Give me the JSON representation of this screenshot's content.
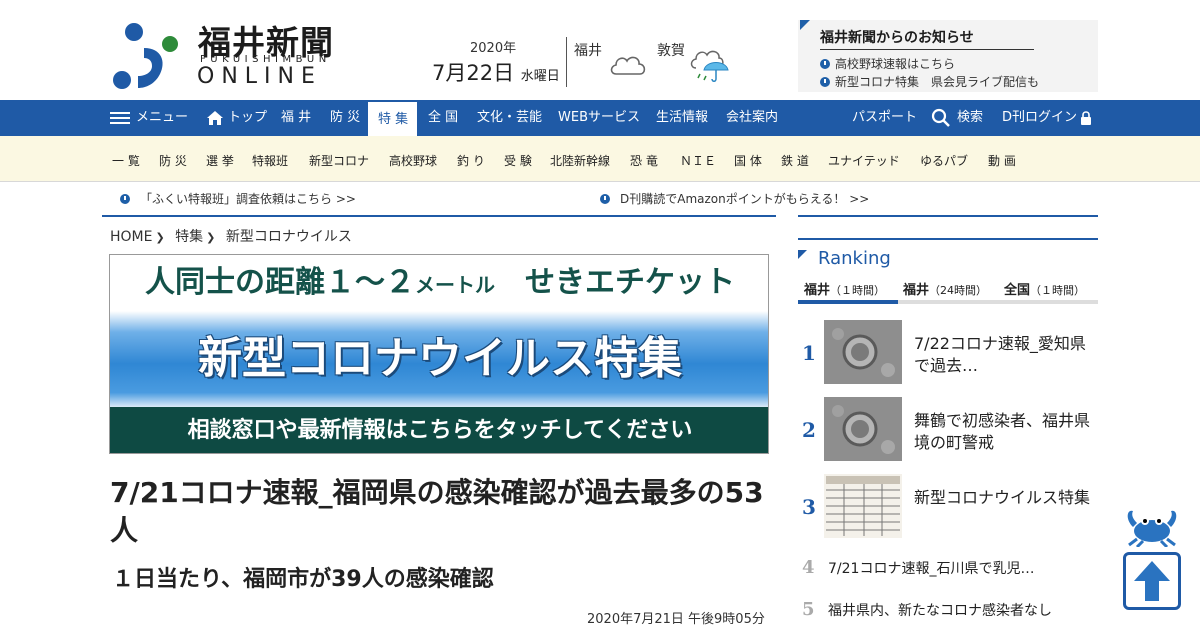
{
  "header": {
    "logo_title": "福井新聞",
    "logo_sub": "FUKUISHIMBUN",
    "logo_online": "ONLINE",
    "date_year": "2020年",
    "date_day": "7月22日",
    "date_weekday": "水曜日",
    "weather": [
      {
        "city": "福井",
        "icon": "cloud-icon"
      },
      {
        "city": "敦賀",
        "icon": "cloud-umbrella-icon"
      }
    ],
    "notice": {
      "title": "福井新聞からのお知らせ",
      "items": [
        "高校野球速報はこちら",
        "新型コロナ特集　県会見ライブ配信も"
      ]
    }
  },
  "nav": {
    "menu_label": "メニュー",
    "items": [
      "トップ",
      "福 井",
      "防 災",
      "特 集",
      "全 国",
      "文化・芸能",
      "WEBサービス",
      "生活情報",
      "会社案内"
    ],
    "active": "特 集",
    "right": {
      "passport": "パスポート",
      "search": "検索",
      "login": "D刊ログイン"
    }
  },
  "subnav": [
    "一 覧",
    "防 災",
    "選 挙",
    "特報班",
    "新型コロナ",
    "高校野球",
    "釣 り",
    "受 験",
    "北陸新幹線",
    "恐 竜",
    "ＮＩＥ",
    "国 体",
    "鉄 道",
    "ユナイテッド",
    "ゆるパブ",
    "動 画"
  ],
  "ticker": [
    "「ふくい特報班」調査依頼はこちら >>",
    "D刊購読でAmazonポイントがもらえる！ >>"
  ],
  "breadcrumb": [
    "HOME",
    "特集",
    "新型コロナウイルス"
  ],
  "banner": {
    "top_a": "人同士の距離１～２",
    "top_b": "メートル",
    "top_c": "　せきエチケット",
    "mid": "新型コロナウイルス特集",
    "bottom": "相談窓口や最新情報はこちらをタッチしてください"
  },
  "article": {
    "headline": "7/21コロナ速報_福岡県の感染確認が過去最多の53人",
    "subhead": "１日当たり、福岡市が39人の感染確認",
    "date": "2020年7月21日 午後9時05分"
  },
  "ranking": {
    "title": "Ranking",
    "tabs": [
      {
        "label": "福井",
        "period": "（１時間）"
      },
      {
        "label": "福井",
        "period": "（24時間）"
      },
      {
        "label": "全国",
        "period": "（１時間）"
      }
    ],
    "items": [
      {
        "rank": "1",
        "text": "7/22コロナ速報_愛知県で過去…"
      },
      {
        "rank": "2",
        "text": "舞鶴で初感染者、福井県境の町警戒"
      },
      {
        "rank": "3",
        "text": "新型コロナウイルス特集"
      },
      {
        "rank": "4",
        "text": "7/21コロナ速報_石川県で乳児…"
      },
      {
        "rank": "5",
        "text": "福井県内、新たなコロナ感染者なし"
      }
    ]
  },
  "colors": {
    "brand": "#1f5aa6",
    "banner_green": "#0e4a43",
    "subnav_bg": "#fbf8e2"
  }
}
